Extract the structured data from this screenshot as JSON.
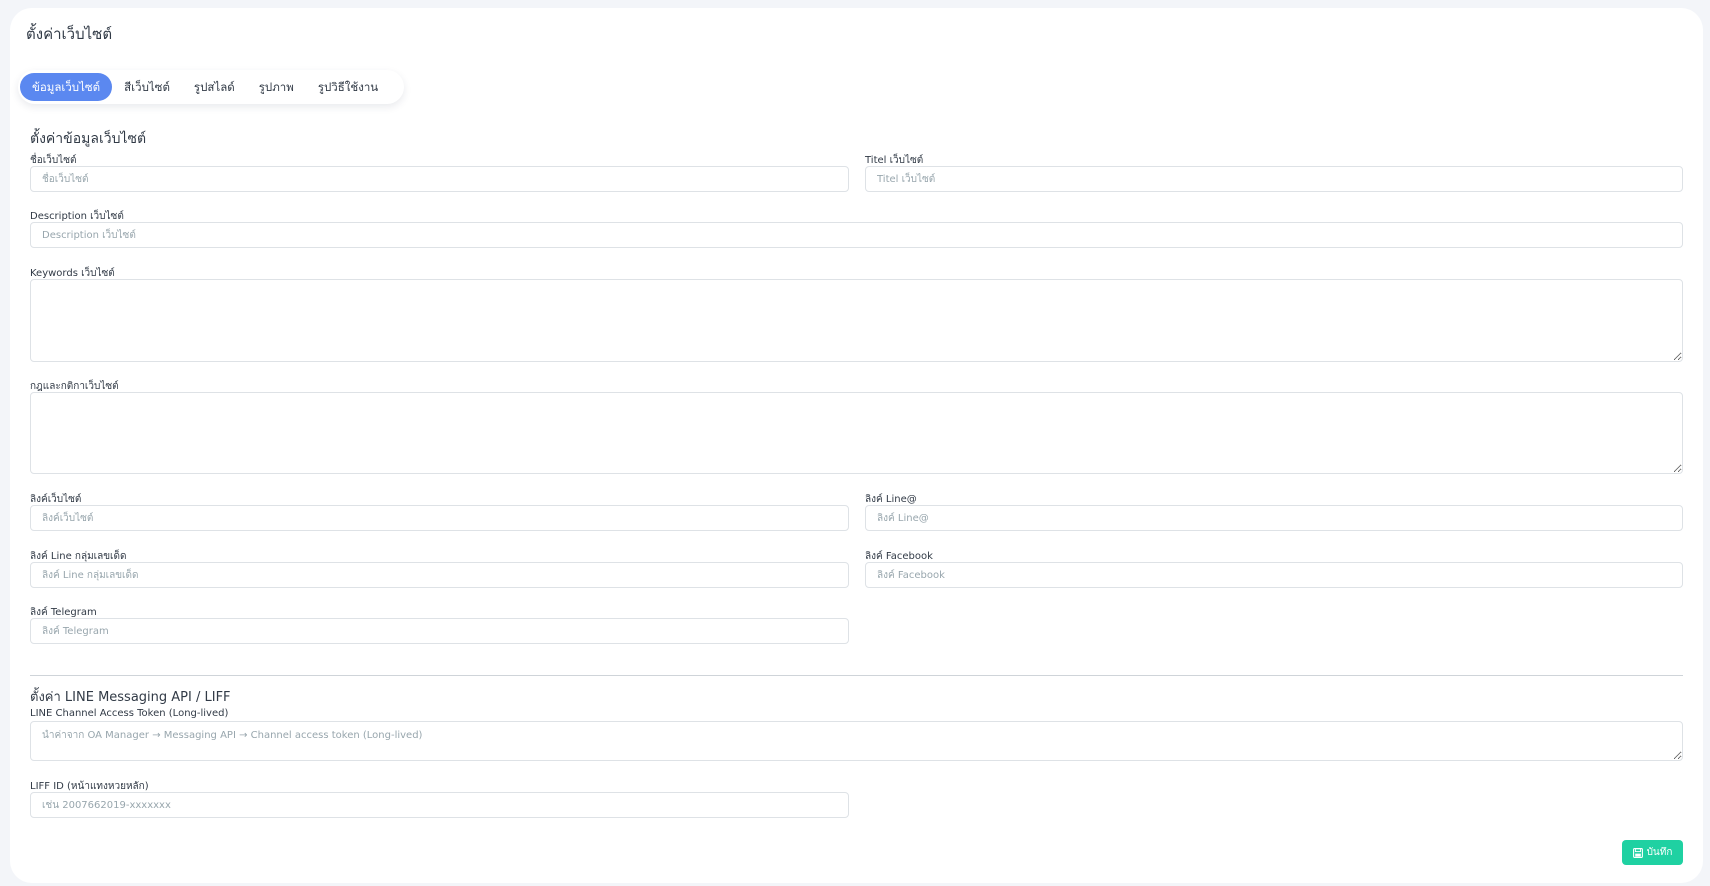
{
  "page": {
    "title": "ตั้งค่าเว็บไซต์"
  },
  "tabs": [
    {
      "label": "ข้อมูลเว็บไซต์",
      "active": true
    },
    {
      "label": "สีเว็บไซต์",
      "active": false
    },
    {
      "label": "รูปสไลด์",
      "active": false
    },
    {
      "label": "รูปภาพ",
      "active": false
    },
    {
      "label": "รูปวิธีใช้งาน",
      "active": false
    }
  ],
  "site_info": {
    "title": "ตั้งค่าข้อมูลเว็บไซต์",
    "site_name": {
      "label": "ชื่อเว็บไซต์",
      "placeholder": "ชื่อเว็บไซต์",
      "value": ""
    },
    "site_title": {
      "label": "Titel เว็บไซต์",
      "placeholder": "Titel เว็บไซต์",
      "value": ""
    },
    "description": {
      "label": "Description เว็บไซต์",
      "placeholder": "Description เว็บไซต์",
      "value": ""
    },
    "keywords": {
      "label": "Keywords เว็บไซต์",
      "placeholder": "",
      "value": ""
    },
    "rules": {
      "label": "กฎและกติกาเว็บไซต์",
      "placeholder": "",
      "value": ""
    },
    "site_link": {
      "label": "ลิงค์เว็บไซต์",
      "placeholder": "ลิงค์เว็บไซต์",
      "value": ""
    },
    "line_link": {
      "label": "ลิงค์ Line@",
      "placeholder": "ลิงค์ Line@",
      "value": ""
    },
    "line_group_link": {
      "label": "ลิงค์ Line กลุ่มเลขเด็ด",
      "placeholder": "ลิงค์ Line กลุ่มเลขเด็ด",
      "value": ""
    },
    "facebook_link": {
      "label": "ลิงค์ Facebook",
      "placeholder": "ลิงค์ Facebook",
      "value": ""
    },
    "telegram_link": {
      "label": "ลิงค์ Telegram",
      "placeholder": "ลิงค์ Telegram",
      "value": ""
    }
  },
  "line_api": {
    "title": "ตั้งค่า LINE Messaging API / LIFF",
    "token": {
      "label": "LINE Channel Access Token (Long-lived)",
      "placeholder": "นำค่าจาก OA Manager → Messaging API → Channel access token (Long-lived)",
      "value": ""
    },
    "liff_id": {
      "label": "LIFF ID (หน้าแทงหวยหลัก)",
      "placeholder": "เช่น 2007662019-xxxxxxx",
      "value": ""
    }
  },
  "actions": {
    "save_label": "บันทึก",
    "save_icon": "floppy-disk-icon"
  },
  "colors": {
    "primary": "#5b88f0",
    "success": "#1fd1a2",
    "border": "#dee2e6",
    "text": "#313a46"
  }
}
